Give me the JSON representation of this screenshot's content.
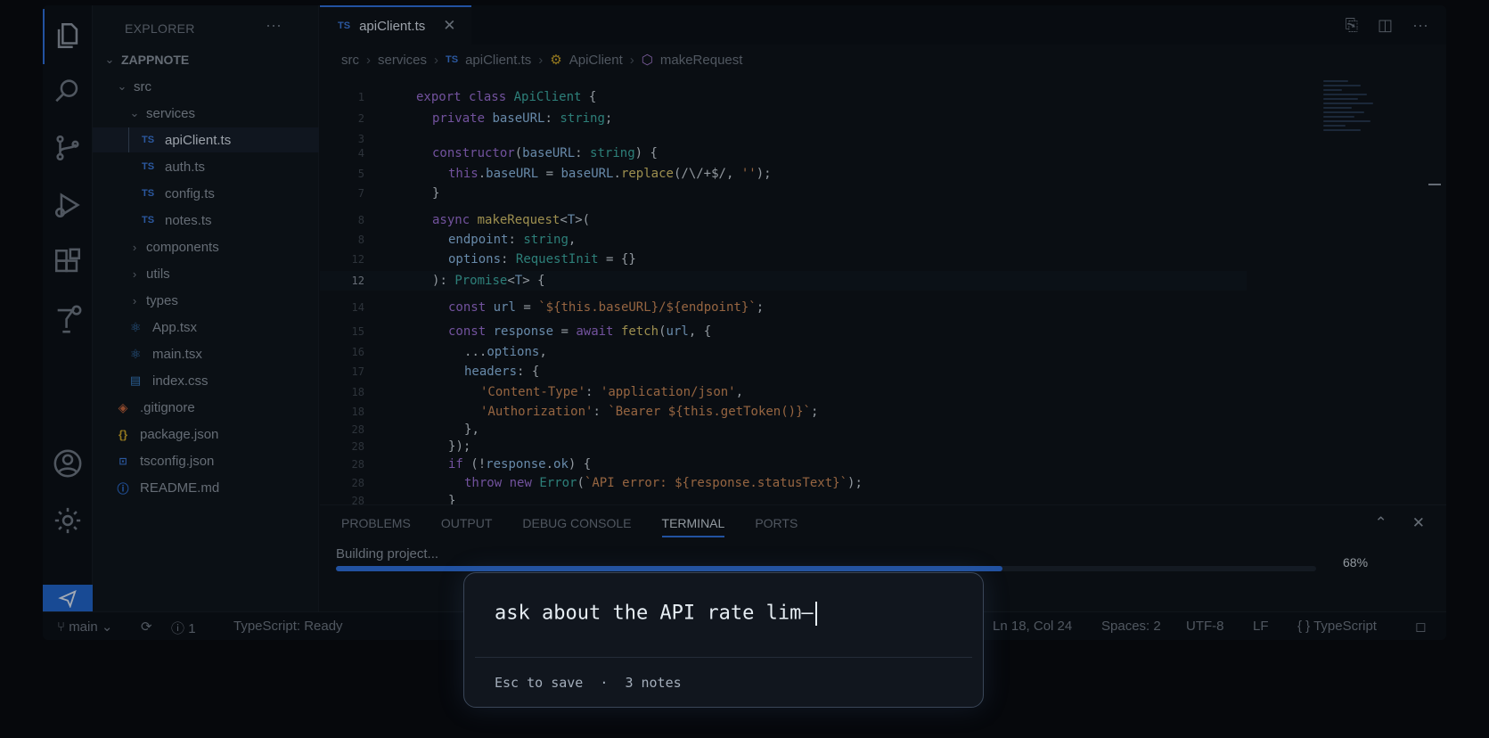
{
  "explorer": {
    "title": "EXPLORER",
    "more": "···",
    "root": "ZAPPNOTE",
    "items": [
      {
        "label": "src"
      },
      {
        "label": "services"
      },
      {
        "label": "apiClient.ts",
        "icon": "TS"
      },
      {
        "label": "auth.ts",
        "icon": "TS"
      },
      {
        "label": "config.ts",
        "icon": "TS"
      },
      {
        "label": "notes.ts",
        "icon": "TS"
      },
      {
        "label": "components"
      },
      {
        "label": "utils"
      },
      {
        "label": "types"
      },
      {
        "label": "App.tsx"
      },
      {
        "label": "main.tsx"
      },
      {
        "label": "index.css"
      },
      {
        "label": ".gitignore"
      },
      {
        "label": "package.json"
      },
      {
        "label": "tsconfig.json"
      },
      {
        "label": "README.md"
      }
    ]
  },
  "tab": {
    "icon": "TS",
    "label": "apiClient.ts",
    "close": "✕"
  },
  "breadcrumb": [
    "src",
    "services",
    "apiClient.ts",
    "ApiClient",
    "makeRequest"
  ],
  "breadcrumb_icon": "TS",
  "code": {
    "lines": [
      {
        "n": "1",
        "text": "export class ApiClient {"
      },
      {
        "n": "2",
        "text": "private baseURL: string;"
      },
      {
        "n": "3",
        "text": ""
      },
      {
        "n": "4",
        "text": "constructor(baseURL: string) {"
      },
      {
        "n": "5",
        "text": "this.baseURL = baseURL.replace(/\\/+$/, '');"
      },
      {
        "n": "7",
        "text": "}"
      },
      {
        "n": "8",
        "text": "async makeRequest<T>("
      },
      {
        "n": "8",
        "text": "endpoint: string,"
      },
      {
        "n": "12",
        "text": "options: RequestInit = {}"
      },
      {
        "n": "12",
        "text": "): Promise<T> {"
      },
      {
        "n": "14",
        "text": "const url = `${this.baseURL}/${endpoint}`;"
      },
      {
        "n": "15",
        "text": "const response = await fetch(url, {"
      },
      {
        "n": "16",
        "text": "...options,"
      },
      {
        "n": "17",
        "text": "headers: {"
      },
      {
        "n": "18",
        "text": "'Content-Type': 'application/json',"
      },
      {
        "n": "18",
        "text": "'Authorization': `Bearer ${this.getToken()}`;"
      },
      {
        "n": "28",
        "text": "},"
      },
      {
        "n": "28",
        "text": "});"
      },
      {
        "n": "28",
        "text": "if (!response.ok) {"
      },
      {
        "n": "28",
        "text": "throw new Error(`API error: ${response.statusText}`);"
      },
      {
        "n": "28",
        "text": "}"
      }
    ]
  },
  "panel": {
    "tabs": [
      "PROBLEMS",
      "OUTPUT",
      "DEBUG CONSOLE",
      "TERMINAL",
      "PORTS"
    ],
    "active_tab": "TERMINAL",
    "build_label": "Building project...",
    "progress": 0.68,
    "progress_text": "68%"
  },
  "status": {
    "branch": "main",
    "problems": "1",
    "ts_status": "TypeScript: Ready",
    "position": "Ln 18, Col 24",
    "spaces": "Spaces: 2",
    "encoding": "UTF-8",
    "eol": "LF",
    "language": "TypeScript",
    "language_icon": "{ }"
  },
  "note_popup": {
    "input_value": "ask about the API rate lim—",
    "hint": "Esc to save",
    "separator": "·",
    "count": "3 notes"
  },
  "colors": {
    "accent": "#2f6fdc",
    "background": "#0d1117"
  }
}
